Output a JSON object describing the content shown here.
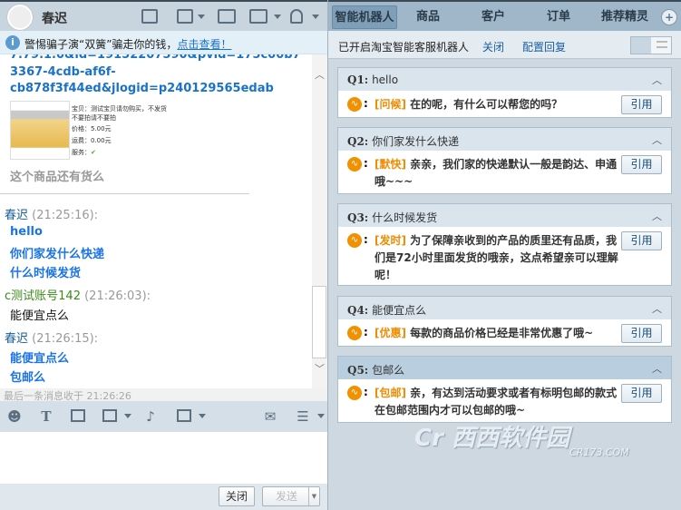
{
  "contact": {
    "name": "春迟"
  },
  "notice": {
    "text": "警惕骗子演“双簧”骗走你的钱，",
    "link": "点击查看！"
  },
  "chat": {
    "url_lines": [
      "7.79.1.0&id=19152207590&pvid=175c00b7",
      "3367-4cdb-af6f-",
      "cb878f3f44ed&jlogid=p240129565edab"
    ],
    "product": {
      "title": "宝贝：测试宝贝请勿购买，不发货不要拍请不要拍",
      "price": "价格：5.00元",
      "shipping": "运费：0.00元",
      "service": "服务："
    },
    "prev_msg": "这个商品还有货么",
    "messages": [
      {
        "sender": "春迟",
        "time": "(21:25:16):",
        "lines": [
          "hello",
          "你们家发什么快递",
          "什么时候发货"
        ]
      },
      {
        "sender": "c测试账号142",
        "time": "(21:26:03):",
        "lines": [
          "能便宜点么"
        ]
      },
      {
        "sender": "春迟",
        "time": "(21:26:15):",
        "lines": [
          "能便宜点么",
          "包邮么"
        ]
      }
    ],
    "status": "最后一条消息收于 21:26:26"
  },
  "footer": {
    "close": "关闭",
    "send": "发送"
  },
  "tabs": [
    "智能机器人",
    "商品",
    "客户",
    "订单",
    "推荐精灵"
  ],
  "robot": {
    "status": "已开启淘宝智能客服机器人",
    "close": "关闭",
    "config": "配置回复"
  },
  "qa": [
    {
      "q": "Q1:",
      "text": "hello",
      "tag": "[问候]",
      "answer": "在的呢，有什么可以帮您的吗？"
    },
    {
      "q": "Q2:",
      "text": "你们家发什么快递",
      "tag": "[默快]",
      "answer": "亲亲，我们家的快递默认一般是韵达、申通哦~~~"
    },
    {
      "q": "Q3:",
      "text": "什么时候发货",
      "tag": "[发时]",
      "answer": "为了保障亲收到的产品的质里还有品质，我们是72小时里面发货的哦亲，这点希望亲可以理解呢！"
    },
    {
      "q": "Q4:",
      "text": "能便宜点么",
      "tag": "[优惠]",
      "answer": "每款的商品价格已经是非常优惠了哦~"
    },
    {
      "q": "Q5:",
      "text": "包邮么",
      "tag": "[包邮]",
      "answer": "亲，有达到活动要求或者有标明包邮的款式在包邮范围内才可以包邮的哦~"
    }
  ],
  "quote_label": "引用",
  "watermark": {
    "cn": "西西软件园",
    "en": "CR173.COM"
  }
}
